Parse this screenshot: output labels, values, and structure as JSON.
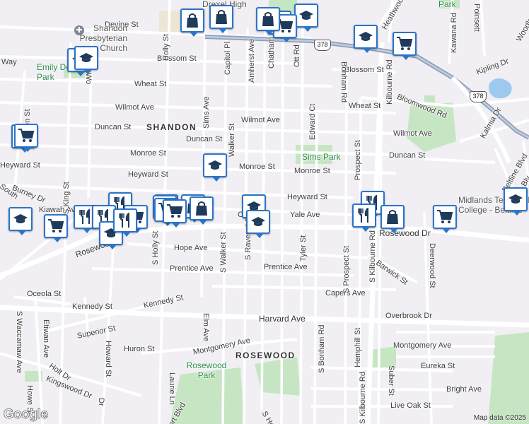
{
  "map": {
    "attribution": "Map data ©2025",
    "logo": "Google",
    "neighborhoods": [
      "SHANDON",
      "ROSEWOOD"
    ],
    "parks": [
      "Emily Douglas Park",
      "Sims Park",
      "Rosewood Park",
      "Park"
    ],
    "poi": [
      "Shandon Presbyterian Church",
      "Drexel High",
      "Midlands Technical College - Beltline"
    ],
    "route_shields": [
      "378",
      "378"
    ],
    "streets": {
      "devine": "Devine St",
      "blossom": "Blossom St",
      "blossom_e": "Blossom St",
      "wheat": "Wheat St",
      "wheat_e": "Wheat St",
      "wilmot": "Wilmot Ave",
      "wilmot_c": "Wilmot Ave",
      "wilmot_e": "Wilmot Ave",
      "duncan": "Duncan St",
      "duncan_c": "Duncan St",
      "duncan_e": "Duncan St",
      "monroe": "Monroe St",
      "monroe_c": "Monroe St",
      "monroe_e": "Monroe St",
      "heyward": "Heyward St",
      "heyward_w": "Heyward St",
      "heyward_e": "Heyward St",
      "yale": "Yale Ave",
      "rosewood": "Rosewood Dr",
      "rosewood_w": "Rosewood",
      "hope": "Hope Ave",
      "prentice": "Prentice Ave",
      "prentice_c": "Prentice Ave",
      "capers": "Capers Ave",
      "kennedy": "Kennedy St",
      "kennedy_c": "Kennedy St",
      "harvard": "Harvard Ave",
      "overbrook": "Overbrook Dr",
      "superior": "Superior St",
      "huron": "Huron St",
      "montgomery": "Montgomery Ave",
      "montgomery_e": "Montgomery Ave",
      "eureka": "Eureka St",
      "bright": "Bright Ave",
      "liveoak": "Live Oak St",
      "holt": "Holt Dr",
      "kingswood": "Kingswood Dr",
      "oceola": "Oceola St",
      "burney": "Burney Dr",
      "kiawah": "Kiawah Ave",
      "bloomwood": "Bloomwood Rd",
      "kipling": "Kipling Dr",
      "kalmia": "Kalmia Dr",
      "barwick": "Barwick St",
      "edward": "Edward Ct",
      "bonham": "Bonham Rd",
      "bonham_s": "S Bonham Rd",
      "kilbourne": "Kilbourne Rd",
      "kilbourne_s": "S Kilbourne Rd",
      "kilbourne_s2": "S Kilbourne Rd",
      "prospect": "Prospect St",
      "prospect_s": "S Prospect St",
      "hemphill": "Hemphill St",
      "suber": "Suber St",
      "deerwood": "Deerwood St",
      "beltline": "Beltline Blvd",
      "ott": "Ott Rd",
      "chatham": "Chatham Ave",
      "amherst": "Amherst Ave",
      "walker": "Walker St",
      "walker_s": "S Walker St",
      "sims": "Sims Ave",
      "capitol": "Capitol Pl",
      "holly": "Holly St",
      "holly_s": "S Holly St",
      "holly_s2": "S Holly St",
      "ravenel": "S Ravenel St",
      "tyler": "Tyler St",
      "elm": "Elm Ave",
      "laurie": "Laurie Ln",
      "king": "S King St",
      "waccamaw": "S Waccamaw Ave",
      "etiwan": "Etiwan Ave",
      "howard": "Howard St",
      "howe": "Howe St",
      "way": "Way",
      "woodrow": "Wo",
      "ott_blvd": "ort Blvd",
      "poinsett": "Poinsett",
      "kawana": "Kawana Rd",
      "heathwood": "Heathwood Cir",
      "woodland": "Woodlan",
      "dr": "Dr",
      "south": "South",
      "edge_st": "en St",
      "c_lbl": "C",
      "blvd_e": "Blv"
    },
    "markers": [
      {
        "icon": "school-icon"
      },
      {
        "icon": "shopping-bag-icon"
      },
      {
        "icon": "shopping-bag-icon"
      },
      {
        "icon": "shopping-cart-icon"
      },
      {
        "icon": "shopping-cart-icon"
      },
      {
        "icon": "school-icon"
      },
      {
        "icon": "shopping-bag-icon"
      },
      {
        "icon": "school-icon"
      },
      {
        "icon": "shopping-cart-icon"
      },
      {
        "icon": "school-icon"
      },
      {
        "icon": "shopping-cart-icon"
      },
      {
        "icon": "school-icon"
      },
      {
        "icon": "restaurant-icon"
      },
      {
        "icon": "shopping-cart-icon"
      },
      {
        "icon": "shopping-bag-icon"
      },
      {
        "icon": "school-icon"
      },
      {
        "icon": "school-icon"
      },
      {
        "icon": "restaurant-icon"
      },
      {
        "icon": "shopping-bag-icon"
      },
      {
        "icon": "shopping-cart-icon"
      },
      {
        "icon": "restaurant-icon"
      },
      {
        "icon": "restaurant-icon"
      },
      {
        "icon": "shopping-cart-icon"
      },
      {
        "icon": "school-icon"
      },
      {
        "icon": "shopping-cart-icon"
      },
      {
        "icon": "school-icon"
      },
      {
        "icon": "restaurant-icon"
      },
      {
        "icon": "school-icon"
      },
      {
        "icon": "shopping-cart-icon"
      },
      {
        "icon": "shopping-cart-icon"
      },
      {
        "icon": "shopping-bag-icon"
      },
      {
        "icon": "restaurant-icon"
      },
      {
        "icon": "school-icon"
      },
      {
        "icon": "shopping-cart-icon"
      }
    ],
    "colors": {
      "background": "#f1eff3",
      "road": "#ffffff",
      "highway": "#8ea0bb",
      "park": "#c6e6c3",
      "water": "#9ec9ee",
      "marker": "#2b74c9",
      "marker_icon": "#1f3b5c"
    }
  }
}
